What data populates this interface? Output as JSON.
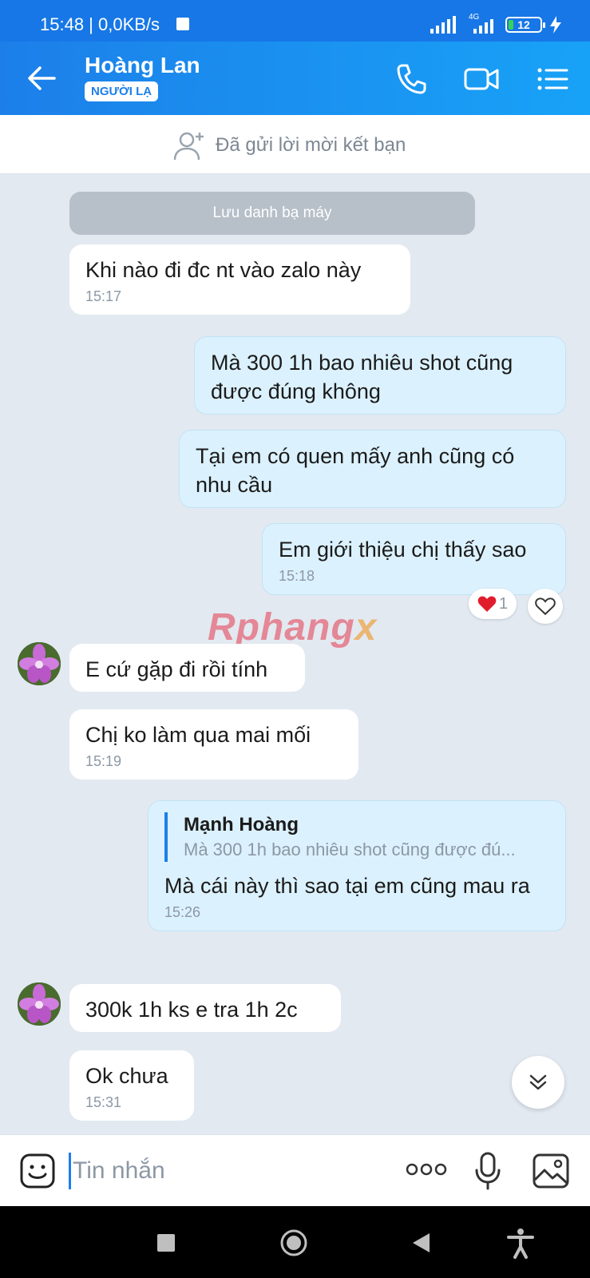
{
  "status_bar": {
    "left_text": "15:48 | 0,0KB/s",
    "network_label": "4G",
    "battery_level": "12"
  },
  "header": {
    "contact_name": "Hoàng Lan",
    "stranger_badge": "NGƯỜI LẠ"
  },
  "friend_request": {
    "text": "Đã gửi lời mời kết bạn"
  },
  "chat": {
    "save_contact_label": "Lưu danh bạ máy",
    "messages": [
      {
        "direction": "in",
        "text": "Khi nào đi đc nt vào zalo này",
        "time": "15:17"
      },
      {
        "direction": "out",
        "text": "Mà 300 1h bao nhiêu shot cũng được đúng không"
      },
      {
        "direction": "out",
        "text": "Tại em có quen mấy anh cũng có nhu cầu"
      },
      {
        "direction": "out",
        "text": "Em giới thiệu chị thấy sao",
        "time": "15:18",
        "reaction_count": "1"
      },
      {
        "direction": "in",
        "text": "E cứ gặp đi rồi tính"
      },
      {
        "direction": "in",
        "text": "Chị ko làm qua mai mối",
        "time": "15:19"
      },
      {
        "direction": "out",
        "quote_name": "Mạnh Hoàng",
        "quote_text": "Mà 300 1h bao nhiêu shot cũng được đú...",
        "text": "Mà cái này thì sao tại em cũng mau ra",
        "time": "15:26"
      },
      {
        "direction": "in",
        "text": "300k 1h ks e tra 1h 2c"
      },
      {
        "direction": "in",
        "text": "Ok chưa",
        "time": "15:31"
      }
    ],
    "watermark": "Rphang",
    "watermark_x": "x"
  },
  "input": {
    "placeholder": "Tin nhắn"
  },
  "colors": {
    "header": "#1c7fe9",
    "outgoing_bubble": "#dbf1fd",
    "incoming_bubble": "#ffffff",
    "chat_background": "#e2e9f1"
  }
}
